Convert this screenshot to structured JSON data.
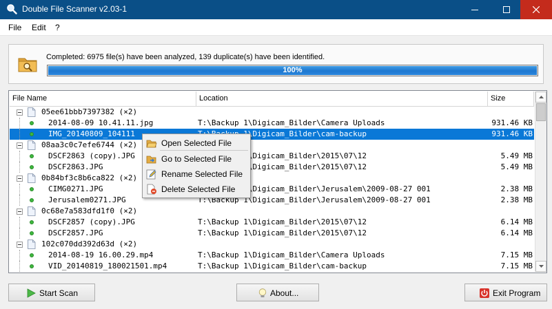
{
  "window": {
    "title": "Double File Scanner v2.03-1"
  },
  "menu": [
    "File",
    "Edit",
    "?"
  ],
  "status": {
    "message": "Completed: 6975 file(s) have been analyzed, 139 duplicate(s) have been identified.",
    "progress": 100,
    "progress_label": "100%"
  },
  "columns": [
    "File Name",
    "Location",
    "Size"
  ],
  "rows": [
    {
      "type": "group",
      "name": "05ee61bbb7397382 (×2)",
      "location": "",
      "size": ""
    },
    {
      "type": "file",
      "name": "2014-08-09 10.41.11.jpg",
      "location": "T:\\Backup 1\\Digicam_Bilder\\Camera Uploads",
      "size": "931.46 KB"
    },
    {
      "type": "file",
      "name": "IMG_20140809_104111",
      "location": "T:\\Backup 1\\Digicam_Bilder\\cam-backup",
      "size": "931.46 KB",
      "selected": true
    },
    {
      "type": "group",
      "name": "08aa3c0c7efe6744 (×2)",
      "location": "",
      "size": ""
    },
    {
      "type": "file",
      "name": "DSCF2863 (copy).JPG",
      "location": "T:\\Backup 1\\Digicam_Bilder\\2015\\07\\12",
      "size": "5.49 MB"
    },
    {
      "type": "file",
      "name": "DSCF2863.JPG",
      "location": "T:\\Backup 1\\Digicam_Bilder\\2015\\07\\12",
      "size": "5.49 MB"
    },
    {
      "type": "group",
      "name": "0b84bf3c8b6ca822 (×2)",
      "location": "",
      "size": ""
    },
    {
      "type": "file",
      "name": "CIMG0271.JPG",
      "location": "T:\\Backup 1\\Digicam_Bilder\\Jerusalem\\2009-08-27 001",
      "size": "2.38 MB"
    },
    {
      "type": "file",
      "name": "Jerusalem0271.JPG",
      "location": "T:\\Backup 1\\Digicam_Bilder\\Jerusalem\\2009-08-27 001",
      "size": "2.38 MB"
    },
    {
      "type": "group",
      "name": "0c68e7a583dfd1f0 (×2)",
      "location": "",
      "size": ""
    },
    {
      "type": "file",
      "name": "DSCF2857 (copy).JPG",
      "location": "T:\\Backup 1\\Digicam_Bilder\\2015\\07\\12",
      "size": "6.14 MB"
    },
    {
      "type": "file",
      "name": "DSCF2857.JPG",
      "location": "T:\\Backup 1\\Digicam_Bilder\\2015\\07\\12",
      "size": "6.14 MB"
    },
    {
      "type": "group",
      "name": "102c070dd392d63d (×2)",
      "location": "",
      "size": ""
    },
    {
      "type": "file",
      "name": "2014-08-19 16.00.29.mp4",
      "location": "T:\\Backup 1\\Digicam_Bilder\\Camera Uploads",
      "size": "7.15 MB"
    },
    {
      "type": "file",
      "name": "VID_20140819_180021501.mp4",
      "location": "T:\\Backup 1\\Digicam_Bilder\\cam-backup",
      "size": "7.15 MB"
    }
  ],
  "context_menu": [
    "Open Selected File",
    "Go to Selected File",
    "Rename Selected File",
    "Delete Selected File"
  ],
  "buttons": {
    "start": "Start Scan",
    "about": "About...",
    "exit": "Exit Program"
  },
  "colors": {
    "titlebar": "#0a4f87",
    "selection": "#0a78d7",
    "progress": "#1e78d0",
    "close": "#c42b1c"
  }
}
